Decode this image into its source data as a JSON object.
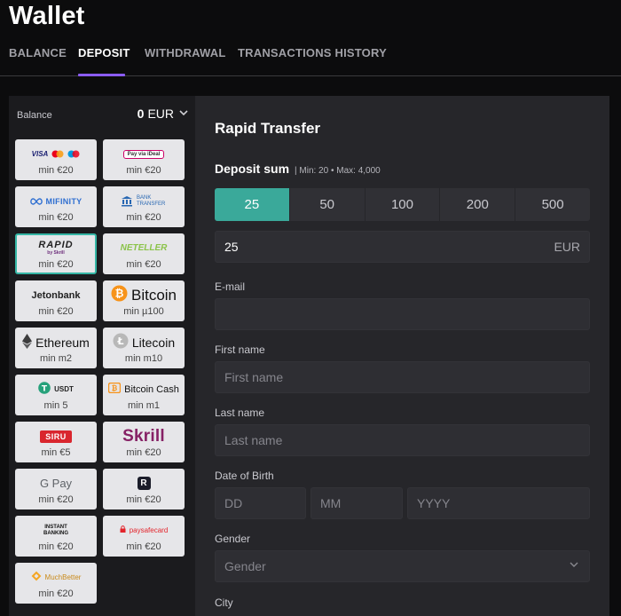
{
  "page_title": "Wallet",
  "tabs": [
    {
      "label": "BALANCE"
    },
    {
      "label": "DEPOSIT"
    },
    {
      "label": "WITHDRAWAL"
    },
    {
      "label": "TRANSACTIONS HISTORY"
    }
  ],
  "balance": {
    "label": "Balance",
    "amount": "0",
    "currency": "EUR"
  },
  "methods": [
    {
      "name": "Visa / Mastercard",
      "logo_text": "VISA",
      "min": "min €20"
    },
    {
      "name": "Pay via iDeal",
      "logo_text": "Pay via iDeal",
      "min": "min €20"
    },
    {
      "name": "MiFinity",
      "logo_text": "MIFINITY",
      "min": "min €20"
    },
    {
      "name": "Bank Transfer",
      "logo_text": "BANK TRANSFER",
      "min": "min €20"
    },
    {
      "name": "Rapid Transfer",
      "logo_text": "RAPID",
      "logo_sub": "by Skrill",
      "min": "min €20"
    },
    {
      "name": "Neteller",
      "logo_text": "NETELLER",
      "min": "min €20"
    },
    {
      "name": "Jetonbank",
      "logo_text": "Jetonbank",
      "min": "min €20"
    },
    {
      "name": "Bitcoin",
      "logo_text": "Bitcoin",
      "min": "min µ100"
    },
    {
      "name": "Ethereum",
      "logo_text": "Ethereum",
      "min": "min m2"
    },
    {
      "name": "Litecoin",
      "logo_text": "Litecoin",
      "min": "min m10"
    },
    {
      "name": "USDT",
      "logo_text": "USDT",
      "min": "min 5"
    },
    {
      "name": "Bitcoin Cash",
      "logo_text": "Bitcoin Cash",
      "min": "min m1"
    },
    {
      "name": "Siru Mobile",
      "logo_text": "SIRU",
      "min": "min €5"
    },
    {
      "name": "Skrill",
      "logo_text": "Skrill",
      "min": "min €20"
    },
    {
      "name": "Google Pay",
      "logo_text": "G Pay",
      "min": "min €20"
    },
    {
      "name": "Revolut",
      "logo_text": "R",
      "min": "min €20"
    },
    {
      "name": "Instant Banking",
      "logo_text": "INSTANT BANKING",
      "min": "min €20"
    },
    {
      "name": "Paysafecard",
      "logo_text": "paysafecard",
      "min": "min €20"
    },
    {
      "name": "MuchBetter",
      "logo_text": "MuchBetter",
      "min": "min €20"
    }
  ],
  "selected_method": "Rapid Transfer",
  "form": {
    "title": "Rapid Transfer",
    "deposit_sum_label": "Deposit sum",
    "limits": "| Min: 20 • Max: 4,000",
    "amount_options": [
      "25",
      "50",
      "100",
      "200",
      "500"
    ],
    "amount_value": "25",
    "currency": "EUR",
    "email_label": "E-mail",
    "email_value": "",
    "first_name_label": "First name",
    "first_name_placeholder": "First name",
    "last_name_label": "Last name",
    "last_name_placeholder": "Last name",
    "dob_label": "Date of Birth",
    "dob_day_placeholder": "DD",
    "dob_month_placeholder": "MM",
    "dob_year_placeholder": "YYYY",
    "gender_label": "Gender",
    "gender_placeholder": "Gender",
    "city_label": "City"
  },
  "colors": {
    "accent_tab": "#8b5cf6",
    "accent_teal": "#3aa99a",
    "background": "#0c0c0d",
    "panel_left": "#1b1b1e",
    "panel_right": "#26262a"
  }
}
